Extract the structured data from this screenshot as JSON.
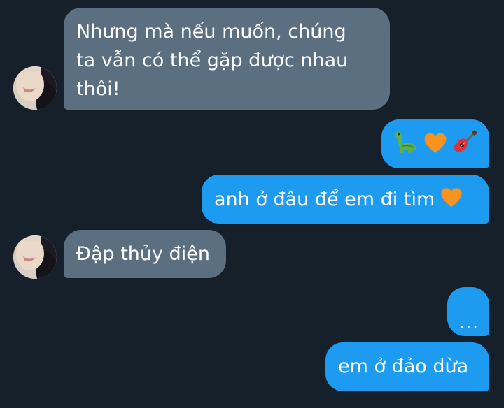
{
  "conversation": {
    "messages": [
      {
        "lines": [
          "Nhưng mà nếu muốn, chúng",
          "ta vẫn có thể gặp được nhau",
          "thôi!"
        ]
      },
      {
        "emojis": [
          "dinosaur-icon",
          "orange-heart-icon",
          "guitar-icon"
        ]
      },
      {
        "text": "anh ở đâu để em đi tìm",
        "trailing_emoji": "orange-heart-icon"
      },
      {
        "text": "Đập thủy điện"
      },
      {
        "text": "..."
      },
      {
        "text": "em ở đảo dừa"
      }
    ]
  },
  "theme": {
    "background": "#15202b",
    "incoming_bubble": "#5b6f80",
    "outgoing_bubble": "#1d9bf0",
    "text": "#ffffff"
  }
}
